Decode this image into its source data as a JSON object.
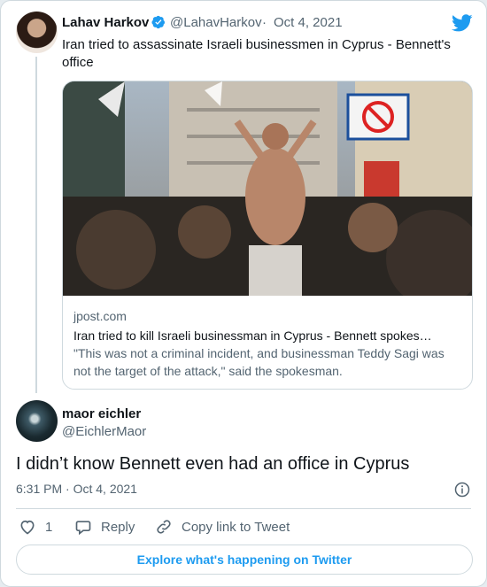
{
  "tweet": {
    "author_name": "Lahav Harkov",
    "author_handle": "@LahavHarkov",
    "separator": "·",
    "date": "Oct 4, 2021",
    "text": "Iran tried to assassinate Israeli businessmen in Cyprus - Bennett's office",
    "link_card": {
      "domain": "jpost.com",
      "headline": "Iran tried to kill Israeli businessman in Cyprus - Bennett spokes…",
      "description": "\"This was not a criminal incident, and businessman Teddy Sagi was not the target of the attack,\" said the spokesman."
    }
  },
  "reply": {
    "author_name": "maor eichler",
    "author_handle": "@EichlerMaor",
    "text": "I didn’t know Bennett even had an office in Cyprus",
    "timestamp": "6:31 PM · Oct 4, 2021"
  },
  "actions": {
    "like_count": "1",
    "reply_label": "Reply",
    "copy_link_label": "Copy link to Tweet"
  },
  "explore_label": "Explore what's happening on Twitter",
  "colors": {
    "accent": "#1d9bf0",
    "secondary_text": "#536471",
    "border": "#cfd9de"
  },
  "icons": [
    "verified-badge-icon",
    "twitter-bird-icon",
    "info-icon",
    "heart-icon",
    "reply-bubble-icon",
    "link-chain-icon"
  ]
}
